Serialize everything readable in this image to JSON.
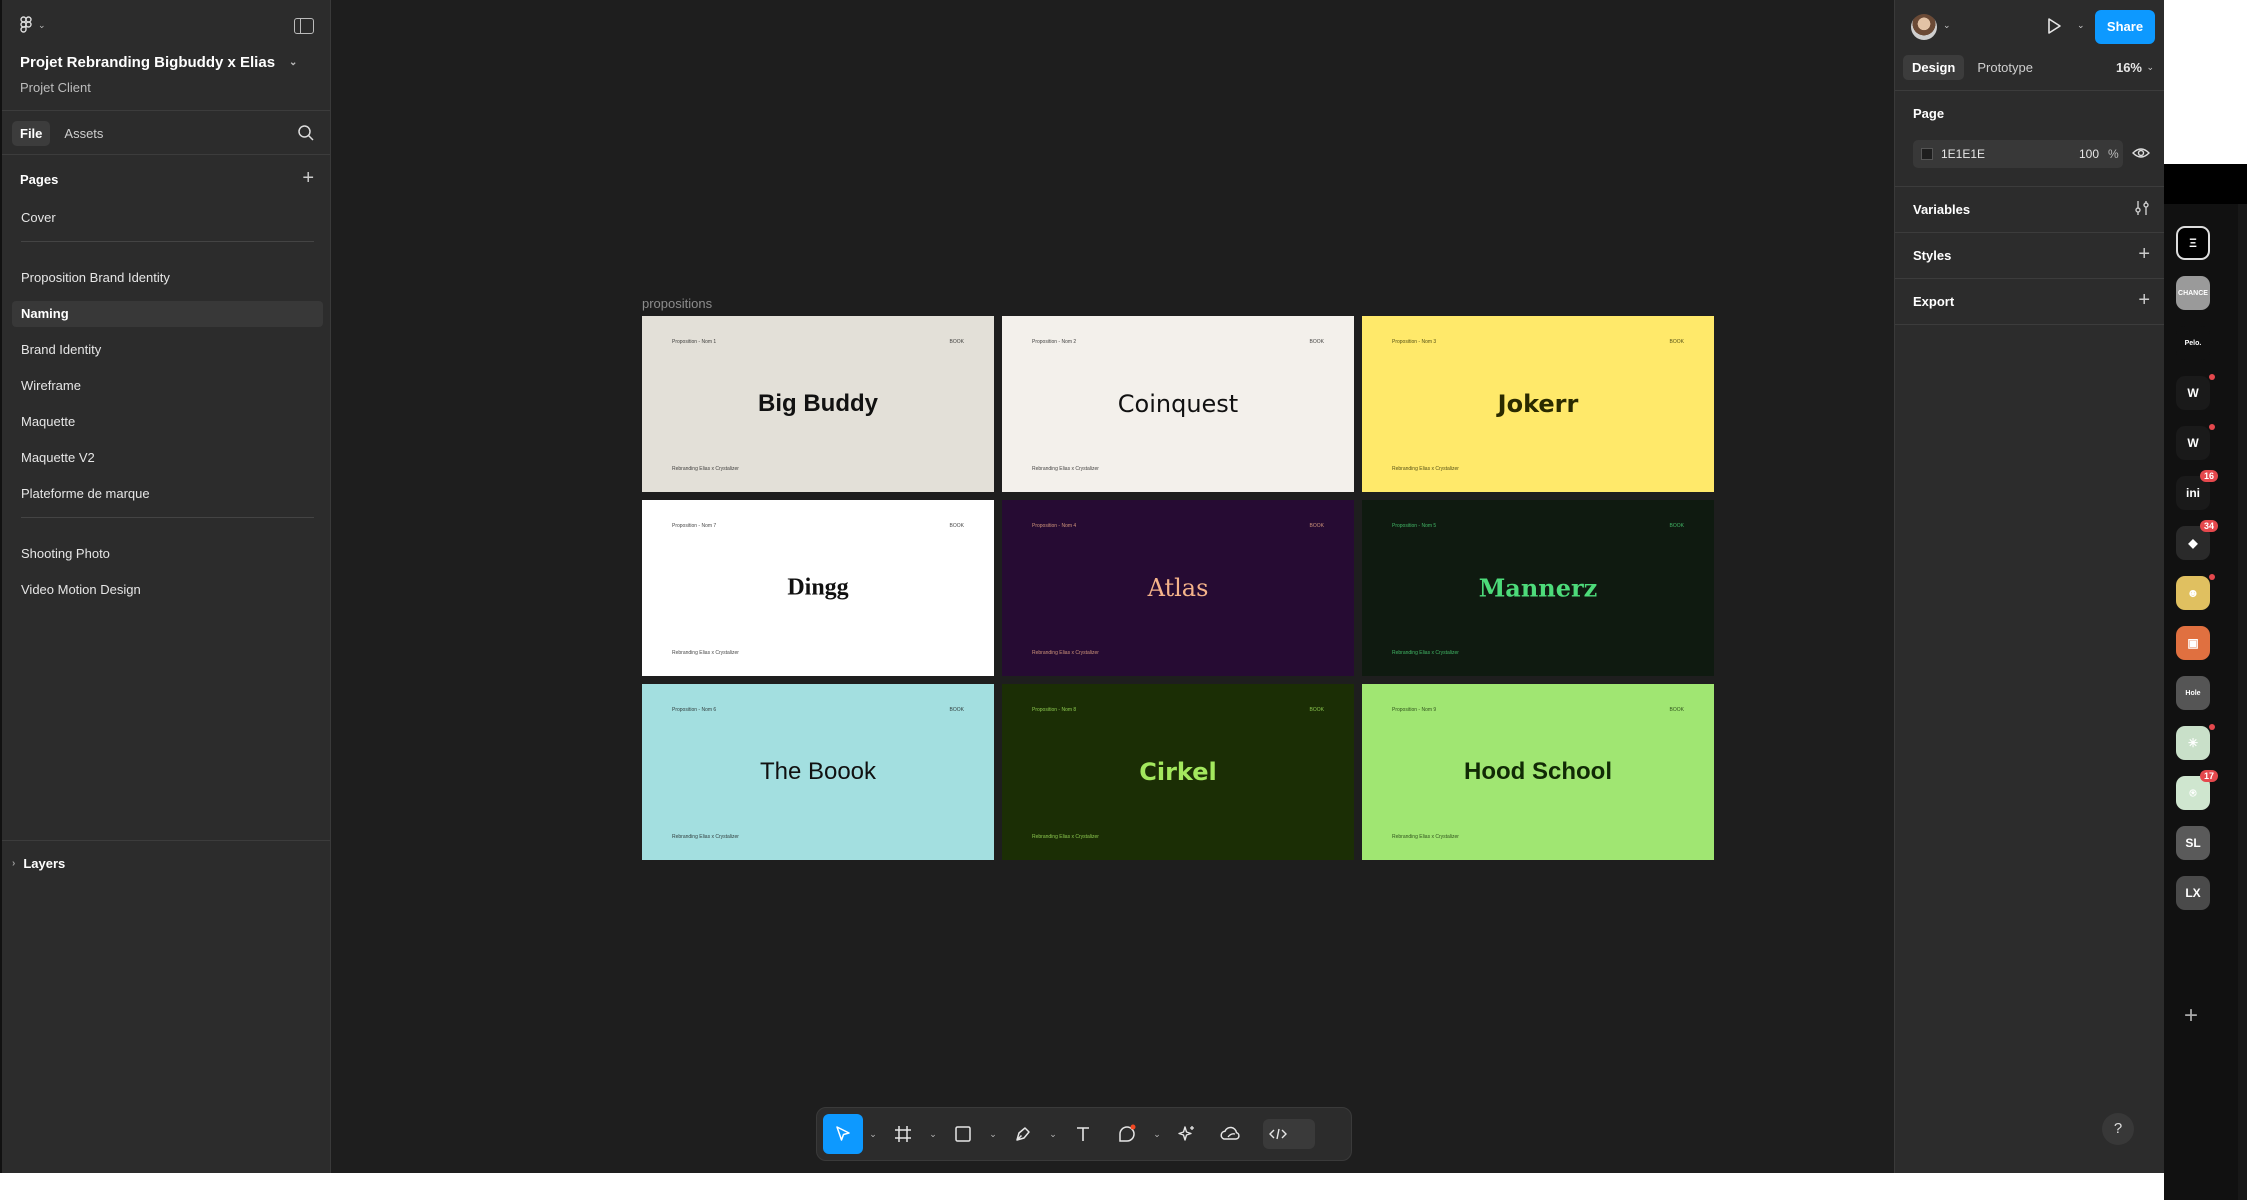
{
  "file": {
    "title": "Projet Rebranding Bigbuddy x Elias",
    "subtitle": "Projet Client"
  },
  "left_panel": {
    "tabs": [
      "File",
      "Assets"
    ],
    "pages_label": "Pages",
    "pages_group1": [
      "Cover"
    ],
    "pages_group2": [
      "Proposition Brand Identity",
      "Naming",
      "Brand Identity",
      "Wireframe",
      "Maquette",
      "Maquette V2",
      "Plateforme de marque"
    ],
    "pages_group3": [
      "Shooting Photo",
      "Video Motion Design"
    ],
    "active_page": "Naming",
    "layers_label": "Layers"
  },
  "canvas": {
    "frame_label": "propositions",
    "cards": [
      {
        "name": "Big Buddy",
        "bg": "#e3e0d8",
        "fg": "#111111",
        "meta_left": "Proposition - Nom 1",
        "meta_right": "BOOK",
        "footer": "Rebranding Elias x Crystalizer"
      },
      {
        "name": "Coinquest",
        "bg": "#f3f0eb",
        "fg": "#111111",
        "meta_left": "Proposition - Nom 2",
        "meta_right": "BOOK",
        "footer": "Rebranding Elias x Crystalizer"
      },
      {
        "name": "Jokerr",
        "bg": "#ffe96a",
        "fg": "#2a2a00",
        "meta_left": "Proposition - Nom 3",
        "meta_right": "BOOK",
        "footer": "Rebranding Elias x Crystalizer"
      },
      {
        "name": "Dingg",
        "bg": "#ffffff",
        "fg": "#111111",
        "meta_left": "Proposition - Nom 7",
        "meta_right": "BOOK",
        "footer": "Rebranding Elias x Crystalizer"
      },
      {
        "name": "Atlas",
        "bg": "#260b33",
        "fg": "#f4b38a",
        "meta_left": "Proposition - Nom 4",
        "meta_right": "BOOK",
        "footer": "Rebranding Elias x Crystalizer"
      },
      {
        "name": "Mannerz",
        "bg": "#0f1a10",
        "fg": "#4ddb7a",
        "meta_left": "Proposition - Nom 5",
        "meta_right": "BOOK",
        "footer": "Rebranding Elias x Crystalizer"
      },
      {
        "name": "The Boook",
        "bg": "#a3dfe0",
        "fg": "#111111",
        "meta_left": "Proposition - Nom 6",
        "meta_right": "BOOK",
        "footer": "Rebranding Elias x Crystalizer"
      },
      {
        "name": "Cirkel",
        "bg": "#1b2e05",
        "fg": "#a3e85e",
        "meta_left": "Proposition - Nom 8",
        "meta_right": "BOOK",
        "footer": "Rebranding Elias x Crystalizer"
      },
      {
        "name": "Hood School",
        "bg": "#a0e672",
        "fg": "#112a05",
        "meta_left": "Proposition - Nom 9",
        "meta_right": "BOOK",
        "footer": "Rebranding Elias x Crystalizer"
      }
    ]
  },
  "right_panel": {
    "share_label": "Share",
    "tabs": [
      "Design",
      "Prototype"
    ],
    "zoom": "16%",
    "page_label": "Page",
    "page_color_hex": "1E1E1E",
    "page_opacity": "100",
    "page_opacity_unit": "%",
    "variables_label": "Variables",
    "styles_label": "Styles",
    "export_label": "Export",
    "help_label": "?"
  },
  "dock": {
    "items": [
      {
        "label": "Ξ",
        "bg": "#000000",
        "badge": "",
        "dot": false,
        "ring": true
      },
      {
        "label": "CHANCE",
        "bg": "#9a9a9a",
        "badge": "",
        "dot": false
      },
      {
        "label": "Pelo.",
        "bg": "#111111",
        "badge": "",
        "dot": false
      },
      {
        "label": "W",
        "bg": "#1a1a1a",
        "badge": "",
        "dot": true
      },
      {
        "label": "W",
        "bg": "#1a1a1a",
        "badge": "",
        "dot": true
      },
      {
        "label": "ini",
        "bg": "#1a1a1a",
        "badge": "16",
        "dot": false
      },
      {
        "label": "◆",
        "bg": "#2a2a2a",
        "badge": "34",
        "dot": false
      },
      {
        "label": "☻",
        "bg": "#e0c060",
        "badge": "",
        "dot": true
      },
      {
        "label": "▣",
        "bg": "#e07040",
        "badge": "",
        "dot": false
      },
      {
        "label": "Hole",
        "bg": "#555555",
        "badge": "",
        "dot": false
      },
      {
        "label": "✳",
        "bg": "#c9e0c9",
        "badge": "",
        "dot": true
      },
      {
        "label": "⍟",
        "bg": "#cfe6cf",
        "badge": "17",
        "dot": false
      },
      {
        "label": "SL",
        "bg": "#5a5a5a",
        "badge": "",
        "dot": false
      },
      {
        "label": "LX",
        "bg": "#4a4a4a",
        "badge": "",
        "dot": false
      }
    ],
    "add_label": "+"
  },
  "colors": {
    "accent": "#0d99ff",
    "canvas_bg": "#1e1e1e",
    "panel_bg": "#2c2c2c"
  }
}
